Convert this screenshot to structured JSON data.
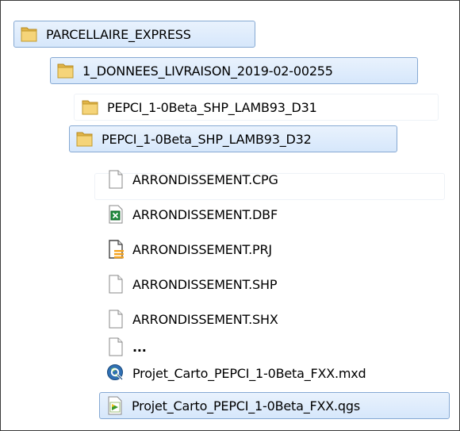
{
  "tree": {
    "root": {
      "label": "PARCELLAIRE_EXPRESS",
      "icon": "folder-icon"
    },
    "delivery": {
      "label": "1_DONNEES_LIVRAISON_2019-02-00255",
      "icon": "folder-icon"
    },
    "folder_d31": {
      "label": "PEPCI_1-0Beta_SHP_LAMB93_D31",
      "icon": "folder-icon"
    },
    "folder_d32": {
      "label": "PEPCI_1-0Beta_SHP_LAMB93_D32",
      "icon": "folder-icon"
    },
    "files": [
      {
        "label": "ARRONDISSEMENT.CPG",
        "icon": "file-icon"
      },
      {
        "label": "ARRONDISSEMENT.DBF",
        "icon": "excel-file-icon"
      },
      {
        "label": "ARRONDISSEMENT.PRJ",
        "icon": "prj-file-icon"
      },
      {
        "label": "ARRONDISSEMENT.SHP",
        "icon": "file-icon"
      },
      {
        "label": "ARRONDISSEMENT.SHX",
        "icon": "file-icon"
      },
      {
        "label": "...",
        "icon": "file-icon"
      }
    ],
    "projects": [
      {
        "label": "Projet_Carto_PEPCI_1-0Beta_FXX.mxd",
        "icon": "arcmap-icon"
      },
      {
        "label": "Projet_Carto_PEPCI_1-0Beta_FXX.qgs",
        "icon": "qgis-icon"
      }
    ]
  }
}
